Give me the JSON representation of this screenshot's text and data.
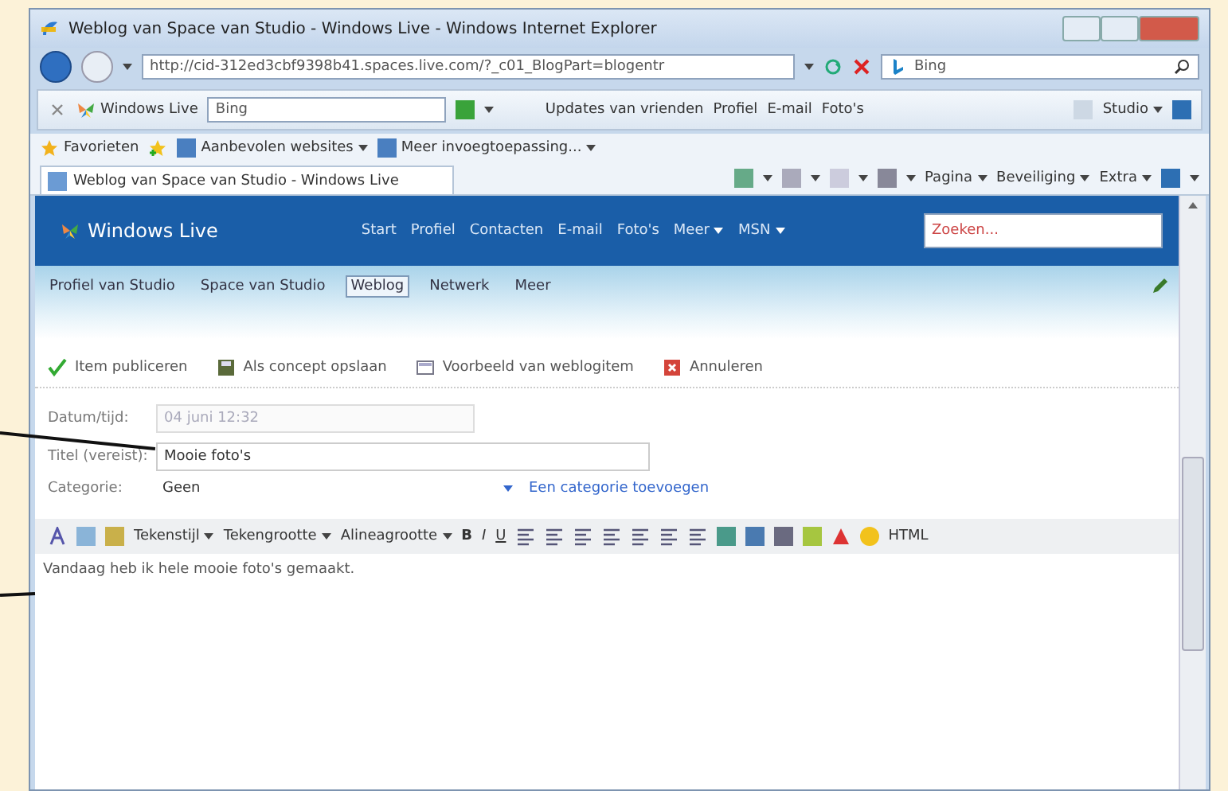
{
  "window": {
    "title": "Weblog van Space van Studio - Windows Live - Windows Internet Explorer"
  },
  "address_bar": {
    "url": "http://cid-312ed3cbf9398b41.spaces.live.com/?_c01_BlogPart=blogentr",
    "search_value": "Bing"
  },
  "live_toolbar": {
    "brand": "Windows Live",
    "search_value": "Bing",
    "links": [
      "Updates van vrienden",
      "Profiel",
      "E-mail",
      "Foto's"
    ],
    "account": "Studio"
  },
  "favorites_bar": {
    "favorites": "Favorieten",
    "items": [
      {
        "label": "Aanbevolen websites"
      },
      {
        "label": "Meer invoegtoepassing..."
      }
    ]
  },
  "tab": {
    "title": "Weblog van Space van Studio - Windows Live"
  },
  "command_bar": [
    "Pagina",
    "Beveiliging",
    "Extra"
  ],
  "site_header": {
    "logo": "Windows Live",
    "nav": [
      {
        "label": "Start",
        "menu": false
      },
      {
        "label": "Profiel",
        "menu": false
      },
      {
        "label": "Contacten",
        "menu": false
      },
      {
        "label": "E-mail",
        "menu": false
      },
      {
        "label": "Foto's",
        "menu": false
      },
      {
        "label": "Meer",
        "menu": true
      },
      {
        "label": "MSN",
        "menu": true
      }
    ],
    "search_placeholder": "Zoeken..."
  },
  "sub_nav": [
    {
      "label": "Profiel van Studio",
      "selected": false
    },
    {
      "label": "Space van Studio",
      "selected": false
    },
    {
      "label": "Weblog",
      "selected": true
    },
    {
      "label": "Netwerk",
      "selected": false
    },
    {
      "label": "Meer",
      "selected": false
    }
  ],
  "actions": [
    {
      "kind": "publish",
      "label": "Item publiceren"
    },
    {
      "kind": "draft",
      "label": "Als concept opslaan"
    },
    {
      "kind": "preview",
      "label": "Voorbeeld van weblogitem"
    },
    {
      "kind": "cancel",
      "label": "Annuleren"
    }
  ],
  "form": {
    "fields": [
      {
        "kind": "text",
        "label": "Datum/tijd:",
        "value": "04 juni 12:32",
        "disabled": true
      },
      {
        "kind": "text",
        "label": "Titel (vereist):",
        "value": "Mooie foto's",
        "disabled": false
      },
      {
        "kind": "select",
        "label": "Categorie:",
        "value": "Geen",
        "link": "Een categorie toevoegen",
        "disabled": false
      }
    ]
  },
  "format_toolbar": {
    "menus": [
      "Tekenstijl",
      "Tekengrootte",
      "Alineagrootte"
    ],
    "bold": "B",
    "italic": "I",
    "underline": "U",
    "html": "HTML"
  },
  "editor": {
    "text": "Vandaag heb ik hele mooie foto's gemaakt."
  }
}
